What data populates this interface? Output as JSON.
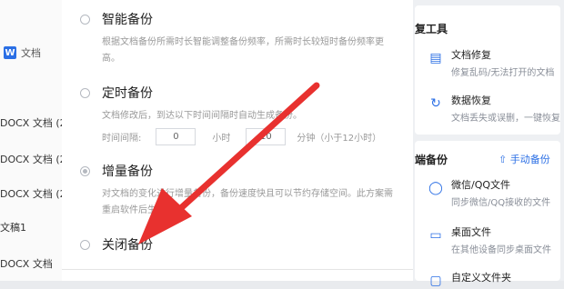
{
  "left_panel": {
    "doc_type_icon": "W",
    "doc_type_label": "文档",
    "files": [
      "DOCX 文档 (2",
      "DOCX 文档 (2",
      "DOCX 文档 (2",
      "文稿1",
      "DOCX 文档"
    ]
  },
  "dialog": {
    "options": [
      {
        "label": "智能备份",
        "description": "根据文档备份所需时长智能调整备份频率，所需时长较短时备份频率更高。",
        "selected": false
      },
      {
        "label": "定时备份",
        "description": "文档修改后，到达以下时间间隔时自动生成备份。",
        "selected": false
      },
      {
        "label": "增量备份",
        "description": "对文档的变化进行增量备份，备份速度快且可以节约存储空间。此方案需重启软件后生效。",
        "selected": true
      },
      {
        "label": "关闭备份",
        "description": "",
        "selected": false
      }
    ],
    "interval": {
      "label": "时间间隔:",
      "hours_value": "0",
      "hours_unit": "小时",
      "minutes_value": "10",
      "minutes_unit": "分钟（小于12小时）"
    }
  },
  "right_panel": {
    "repair_title": "复工具",
    "tools": [
      {
        "icon": "file-repair-icon",
        "title": "文档修复",
        "subtitle": "修复乱码/无法打开的文档"
      },
      {
        "icon": "data-recovery-icon",
        "title": "数据恢复",
        "subtitle": "文档丢失或误删，一键恢复"
      }
    ],
    "backup_title": "端备份",
    "manual_backup": "手动备份",
    "backup_items": [
      {
        "icon": "wechat-icon",
        "title": "微信/QQ文件",
        "subtitle": "同步微信/QQ接收的文件"
      },
      {
        "icon": "desktop-icon",
        "title": "桌面文件",
        "subtitle": "在其他设备同步桌面文件"
      },
      {
        "icon": "folder-icon",
        "title": "自定义文件夹",
        "subtitle": ""
      }
    ]
  },
  "colors": {
    "accent": "#2b6fe5",
    "arrow": "#e8312f"
  }
}
